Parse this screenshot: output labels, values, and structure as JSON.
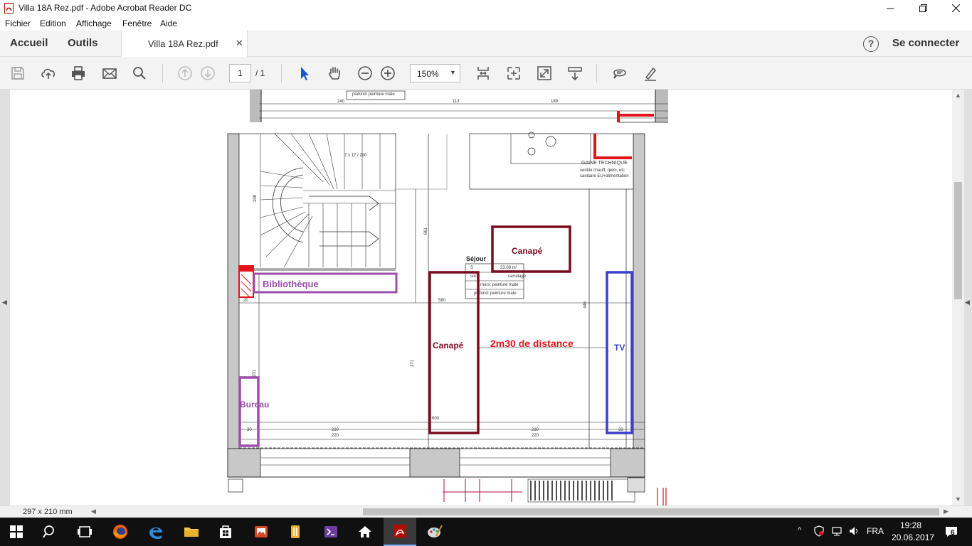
{
  "window": {
    "title": "Villa 18A Rez.pdf - Adobe Acrobat Reader DC"
  },
  "menu": [
    "Fichier",
    "Edition",
    "Affichage",
    "Fenêtre",
    "Aide"
  ],
  "tabs": {
    "home": "Accueil",
    "tools": "Outils",
    "document": "Villa 18A Rez.pdf",
    "sign_in": "Se connecter"
  },
  "toolbar": {
    "page_current": "1",
    "page_total": "/ 1",
    "zoom": "150%"
  },
  "plan": {
    "room_name": "Séjour",
    "room_area_prefix": "S",
    "room_area": "23.08 m²",
    "room_floor_prefix": "sol:",
    "room_floor": "carrelage",
    "room_walls": "murs: peinture mate",
    "room_ceiling": "plafond: peinture mate",
    "top_ceiling_note": "plafond: peinture mate",
    "gaine_title": "GAINE TECHNIQUE",
    "gaine_line1": "ventilo chauff, rjeim, etc",
    "gaine_line2": "sanitaire EU+alimentation",
    "stair_note": "7 x 17 / 290",
    "dims": {
      "d240": "240",
      "d113": "113",
      "d189": "189",
      "d580": "580",
      "d600": "600",
      "d271": "271",
      "d446": "446",
      "d661": "661",
      "d208": "208",
      "d230a": "230",
      "d220a": "220",
      "d230b": "230",
      "d220b": "220",
      "d30": "30",
      "d20": "20",
      "d231": "231",
      "d33": "33"
    },
    "annotations": {
      "bibliotheque": "Bibliothèque",
      "canape_top": "Canapé",
      "canape_left": "Canapé",
      "distance": "2m30 de distance",
      "tv": "TV",
      "bureau": "Bureau"
    },
    "annotation_colors": {
      "purple": "#9b4fa8",
      "maroon": "#7b0a1e",
      "blue": "#3b3fcf",
      "red": "#e1141b"
    }
  },
  "status": {
    "page_size": "297 x 210 mm"
  },
  "taskbar": {
    "language": "FRA",
    "time": "19:28",
    "date": "20.06.2017",
    "notifications": "6"
  }
}
